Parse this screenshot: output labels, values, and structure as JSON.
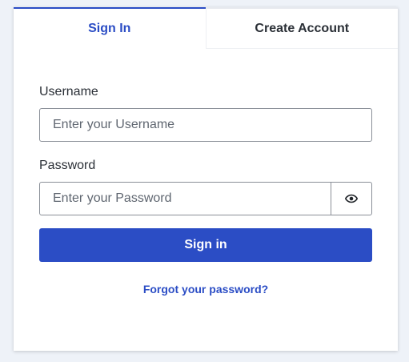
{
  "tabs": {
    "sign_in": "Sign In",
    "create_account": "Create Account"
  },
  "form": {
    "username_label": "Username",
    "username_placeholder": "Enter your Username",
    "password_label": "Password",
    "password_placeholder": "Enter your Password",
    "show_password_icon": "eye-icon",
    "submit_label": "Sign in",
    "forgot_label": "Forgot your password?"
  },
  "colors": {
    "accent": "#2b4dc5",
    "background": "#eef2f8",
    "text": "#2a2f36"
  }
}
